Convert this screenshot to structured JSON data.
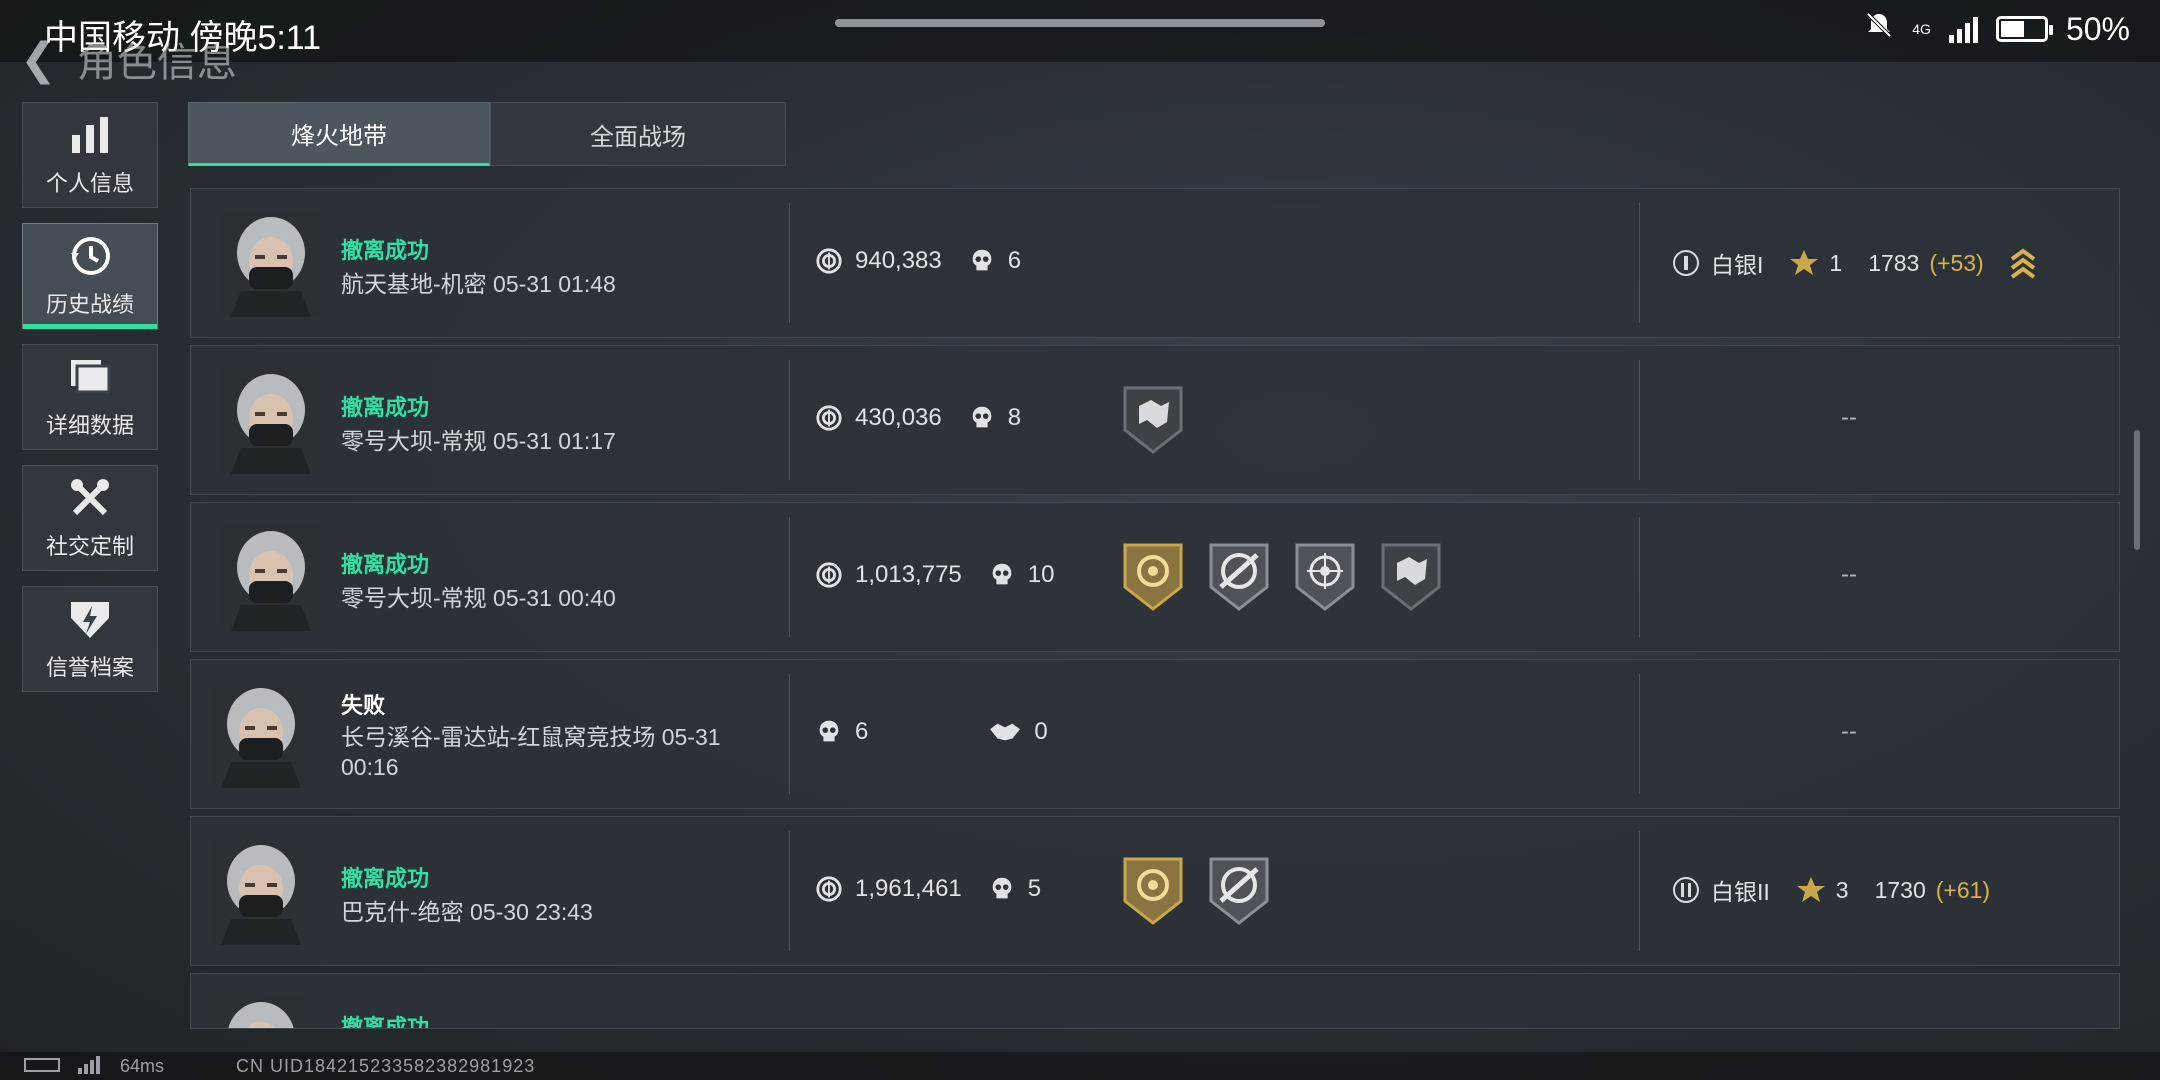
{
  "status_bar": {
    "carrier_time": "中国移动 傍晚5:11",
    "network": "4G",
    "battery": "50%"
  },
  "header": {
    "title": "角色信息"
  },
  "sidebar": {
    "items": [
      {
        "label": "个人信息",
        "icon": "bar-chart-icon",
        "active": false
      },
      {
        "label": "历史战绩",
        "icon": "history-clock-icon",
        "active": true
      },
      {
        "label": "详细数据",
        "icon": "folder-icon",
        "active": false
      },
      {
        "label": "社交定制",
        "icon": "tools-icon",
        "active": false
      },
      {
        "label": "信誉档案",
        "icon": "shield-bolt-icon",
        "active": false
      }
    ]
  },
  "tabs": [
    {
      "label": "烽火地带",
      "active": true
    },
    {
      "label": "全面战场",
      "active": false
    }
  ],
  "matches": [
    {
      "result": "撤离成功",
      "success": true,
      "map_time": "航天基地-机密 05-31 01:48",
      "value": "940,383",
      "kills": "6",
      "badges": [],
      "rank": {
        "tier": "白银I",
        "stars": "1",
        "score": "1783",
        "delta": "(+53)",
        "up_icon": true
      }
    },
    {
      "result": "撤离成功",
      "success": true,
      "map_time": "零号大坝-常规 05-31 01:17",
      "value": "430,036",
      "kills": "8",
      "badges": [
        "dark-shield-badge"
      ],
      "rank_dash": "--"
    },
    {
      "result": "撤离成功",
      "success": true,
      "map_time": "零号大坝-常规 05-31 00:40",
      "value": "1,013,775",
      "kills": "10",
      "badges": [
        "gold-shield-badge",
        "grey-crosshair-badge",
        "grey-target-badge",
        "dark-shield-badge"
      ],
      "rank_dash": "--"
    },
    {
      "result": "失败",
      "success": false,
      "map_time": "长弓溪谷-雷达站-红鼠窝竞技场 05-31 00:16",
      "kills": "6",
      "assists": "0",
      "badges": [],
      "rank_dash": "--"
    },
    {
      "result": "撤离成功",
      "success": true,
      "map_time": "巴克什-绝密 05-30 23:43",
      "value": "1,961,461",
      "kills": "5",
      "badges": [
        "gold-shield-badge",
        "grey-crosshair-badge"
      ],
      "rank": {
        "tier": "白银II",
        "stars": "3",
        "score": "1730",
        "delta": "(+61)",
        "up_icon": false
      }
    },
    {
      "result": "撤离成功",
      "success": true,
      "partial": true
    }
  ],
  "bottom_bar": {
    "ping": "64ms",
    "uid": "CN UID1842152335823829819​23"
  },
  "colors": {
    "accent": "#2fe0a4",
    "gold": "#d6b44a",
    "row_bg": "#2c3238"
  }
}
